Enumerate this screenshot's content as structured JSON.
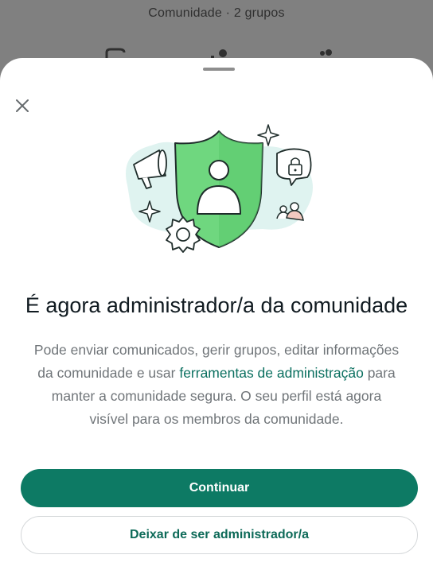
{
  "background": {
    "title": "Comunidade · 2 grupos"
  },
  "sheet": {
    "close_icon": "close-icon",
    "illustration": "admin-shield-illustration",
    "title": "É agora administrador/a da comunidade",
    "body_part1": "Pode enviar comunicados, gerir grupos, editar informações da comunidade e usar ",
    "body_link": "ferramentas de administração",
    "body_part2": " para manter a comunidade segura. O seu perfil está agora visível para os membros da comunidade.",
    "primary_button": "Continuar",
    "secondary_button": "Deixar de ser administrador/a"
  },
  "colors": {
    "accent": "#0d7a64",
    "link": "#0b7060",
    "shield": "#6fd77f",
    "blob": "#dff3f0"
  }
}
